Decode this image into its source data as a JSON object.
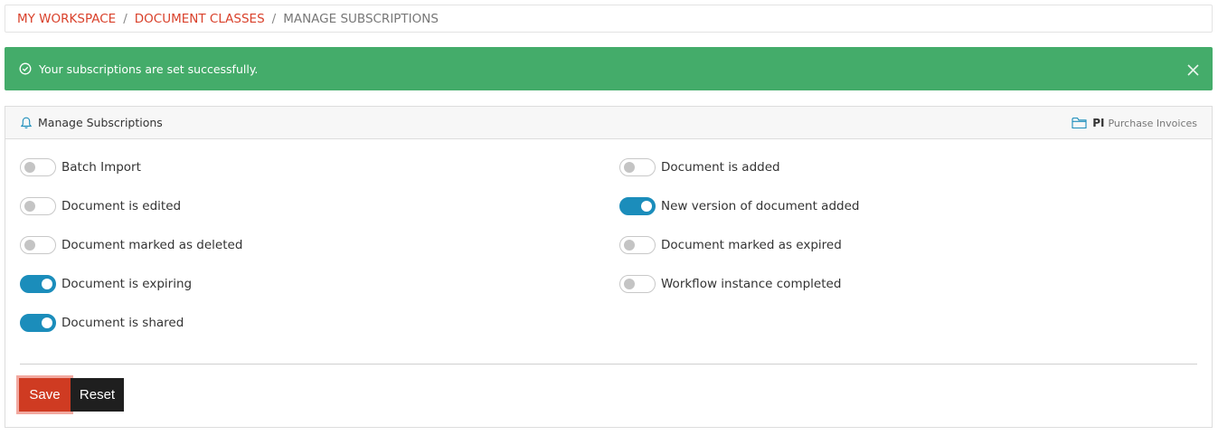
{
  "breadcrumb": {
    "items": [
      "MY WORKSPACE",
      "DOCUMENT CLASSES"
    ],
    "current": "MANAGE SUBSCRIPTIONS",
    "separator": "/"
  },
  "alert": {
    "message": "Your subscriptions are set successfully.",
    "icon": "check-circle-icon",
    "close_icon": "close-icon",
    "color": "#44ac6a"
  },
  "panel": {
    "title": "Manage Subscriptions",
    "title_icon": "bell-icon",
    "class_code": "PI",
    "class_name": "Purchase Invoices",
    "class_icon": "folder-icon"
  },
  "subscriptions": {
    "left": [
      {
        "label": "Batch Import",
        "on": false
      },
      {
        "label": "Document is edited",
        "on": false
      },
      {
        "label": "Document marked as deleted",
        "on": false
      },
      {
        "label": "Document is expiring",
        "on": true
      },
      {
        "label": "Document is shared",
        "on": true
      }
    ],
    "right": [
      {
        "label": "Document is added",
        "on": false
      },
      {
        "label": "New version of document added",
        "on": true
      },
      {
        "label": "Document marked as expired",
        "on": false
      },
      {
        "label": "Workflow instance completed",
        "on": false
      }
    ]
  },
  "actions": {
    "save_label": "Save",
    "reset_label": "Reset"
  },
  "colors": {
    "accent": "#d9412b",
    "toggle_on": "#1b8dbb",
    "save": "#cf3b22",
    "reset": "#1f1f1f"
  }
}
